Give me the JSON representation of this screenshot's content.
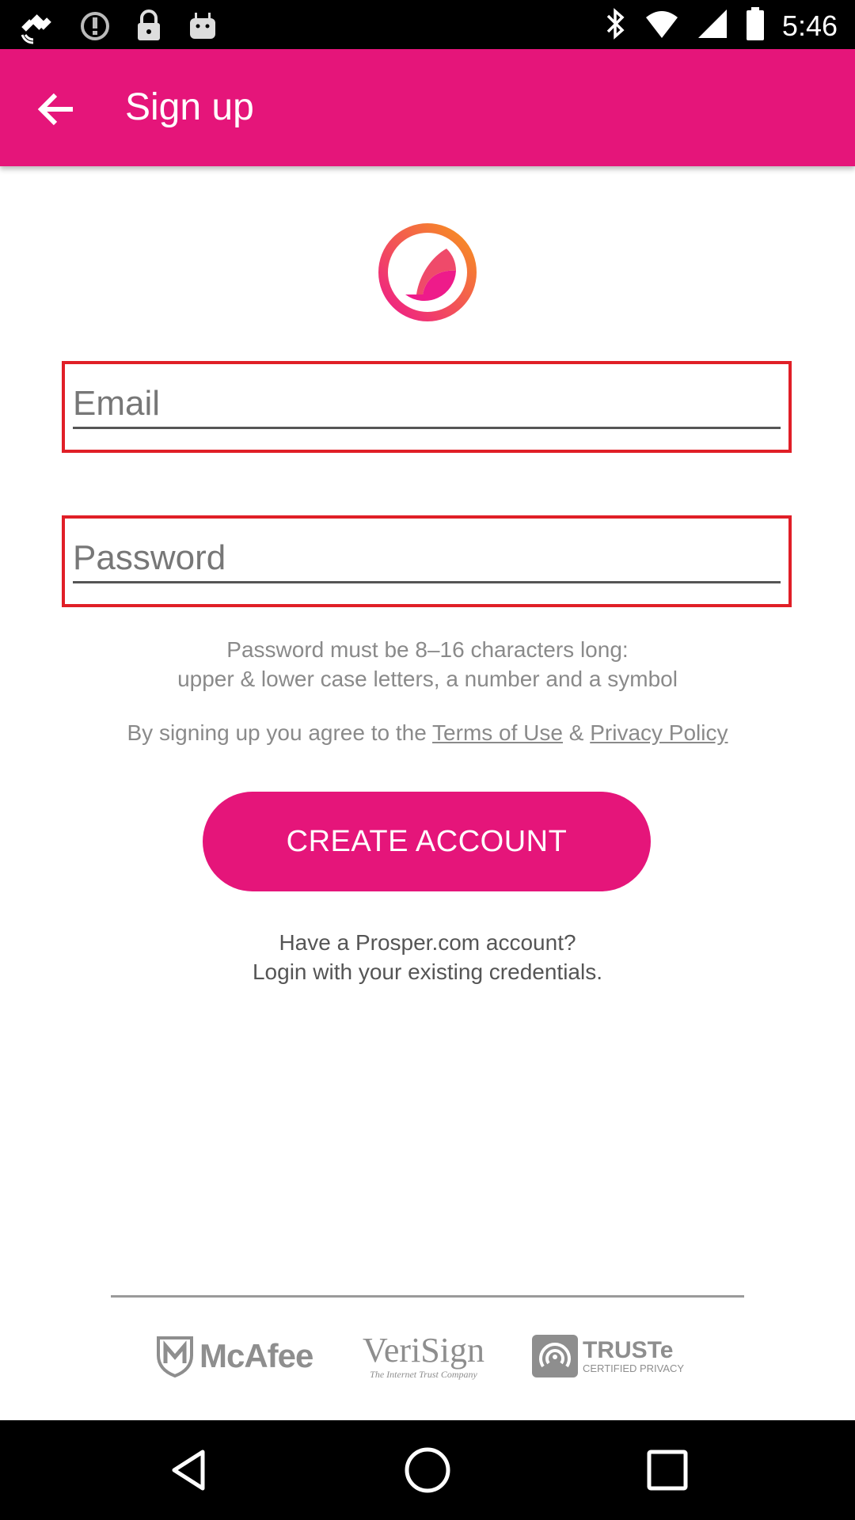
{
  "status_bar": {
    "time": "5:46",
    "icons": [
      "satellite-icon",
      "alert-icon",
      "lock-icon",
      "android-icon",
      "bluetooth-icon",
      "wifi-icon",
      "signal-icon",
      "battery-icon"
    ]
  },
  "app_bar": {
    "title": "Sign up",
    "back_icon": "arrow-back-icon",
    "color": "#e5157a"
  },
  "form": {
    "email_placeholder": "Email",
    "email_value": "",
    "password_placeholder": "Password",
    "password_value": "",
    "error_border_color": "#e01f27"
  },
  "hint": {
    "line1": "Password must be 8–16 characters long:",
    "line2": "upper & lower case letters, a number and a symbol"
  },
  "agree": {
    "prefix": "By signing up you agree to the",
    "terms": "Terms of Use",
    "amp": "&",
    "privacy": "Privacy Policy"
  },
  "create_button": "CREATE ACCOUNT",
  "login": {
    "line1": "Have a Prosper.com account?",
    "line2": "Login with your existing credentials."
  },
  "trust_badges": {
    "mcafee": "McAfee",
    "verisign": "VeriSign",
    "verisign_tagline": "The Internet Trust Company",
    "truste": "TRUSTe",
    "truste_sub": "CERTIFIED PRIVACY"
  },
  "nav_bar": [
    "back-triangle-icon",
    "home-circle-icon",
    "recents-square-icon"
  ]
}
